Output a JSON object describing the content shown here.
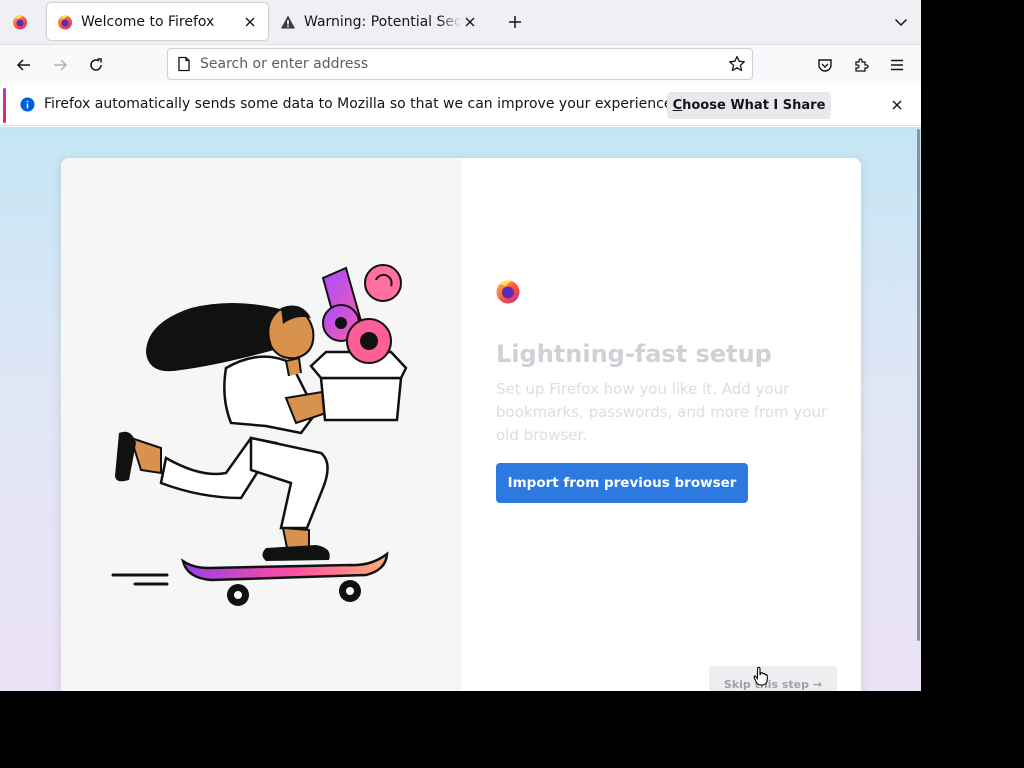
{
  "tabs": [
    {
      "label": "Welcome to Firefox",
      "icon": "firefox-icon",
      "active": true
    },
    {
      "label": "Warning: Potential Security Risk Ahead",
      "icon": "warning-icon",
      "active": false
    }
  ],
  "navbar": {
    "url_placeholder": "Search or enter address"
  },
  "notification": {
    "message": "Firefox automatically sends some data to Mozilla so that we can improve your experience.",
    "button_accesskey": "C",
    "button_rest": "hoose What I Share"
  },
  "onboarding": {
    "headline": "Lightning-fast setup",
    "subtext": "Set up Firefox how you like it. Add your bookmarks, passwords, and more from your old browser.",
    "primary_button": "Import from previous browser",
    "skip_button": "Skip this step →"
  },
  "colors": {
    "accent_blue": "#2c7ae0",
    "tab_bg": "#f0f0f4",
    "toolbar_bg": "#f9f9fb"
  }
}
